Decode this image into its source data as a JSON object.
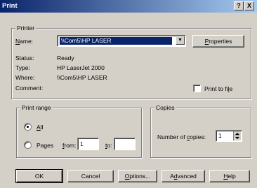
{
  "window": {
    "title": "Print"
  },
  "titlebar": {
    "help_label": "?",
    "close_label": "X"
  },
  "printer": {
    "group_label": "Printer",
    "name_label": "Name:",
    "name_value": "\\\\Com5\\HP LASER",
    "properties_label": "Properties",
    "status_label": "Status:",
    "status_value": "Ready",
    "type_label": "Type:",
    "type_value": "HP LaserJet 2000",
    "where_label": "Where:",
    "where_value": "\\\\Com5\\HP LASER",
    "comment_label": "Comment:",
    "print_to_file_label": "Print to file",
    "print_to_file_checked": false
  },
  "print_range": {
    "group_label": "Print range",
    "all_label": "All",
    "pages_label": "Pages",
    "from_label": "from:",
    "from_value": "1",
    "to_label": "to:",
    "to_value": "",
    "selected": "all"
  },
  "copies": {
    "group_label": "Copies",
    "number_label": "Number of copies:",
    "number_value": "1"
  },
  "buttons": {
    "ok": "OK",
    "cancel": "Cancel",
    "options": "Options...",
    "advanced": "Advanced",
    "help": "Help"
  },
  "icons": {
    "dropdown": "chevron-down-icon",
    "spin": "spin-arrows-icon"
  },
  "colors": {
    "titlebar_start": "#0a246a",
    "titlebar_end": "#a6caf0",
    "selection": "#0a246a",
    "face": "#d4d0c8"
  }
}
